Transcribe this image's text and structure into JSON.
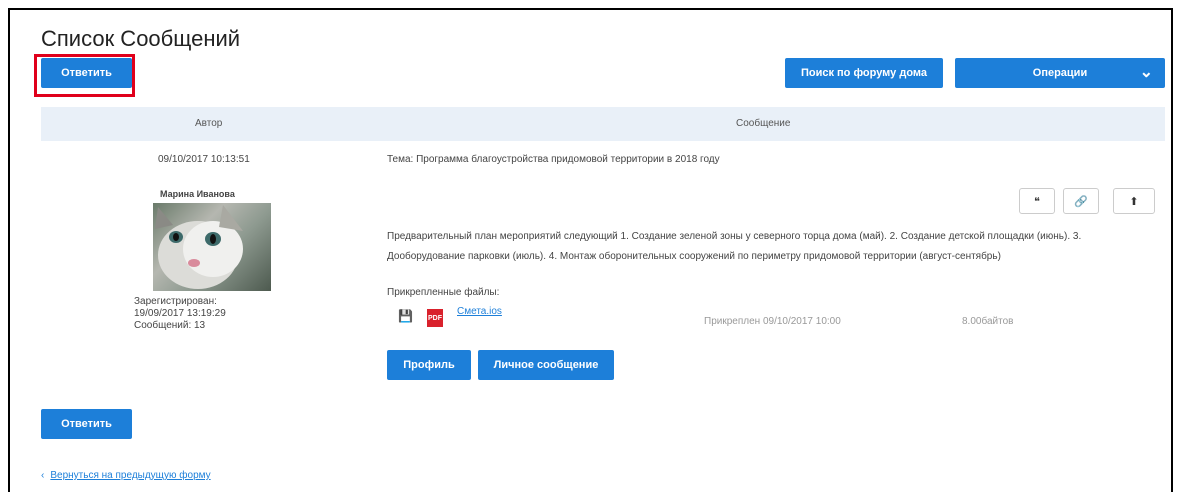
{
  "page": {
    "title": "Список Сообщений"
  },
  "toolbar": {
    "reply_label": "Ответить",
    "search_label": "Поиск по форуму дома",
    "operations_label": "Операции"
  },
  "table": {
    "col_author": "Автор",
    "col_message": "Сообщение"
  },
  "post": {
    "date": "09/10/2017 10:13:51",
    "subject": "Тема: Программа благоустройства придомовой территории в 2018 году",
    "author": "Марина Иванова",
    "registered_label": "Зарегистрирован:",
    "registered_date": "19/09/2017 13:19:29",
    "messages_count": "Сообщений: 13",
    "body": "Предварительный план мероприятий следующий 1. Создание зеленой зоны у северного торца дома (май). 2. Создание детской площадки (июнь). 3. Дооборудование парковки (июль). 4. Монтаж оборонительных сооружений по периметру придомовой территории (август-сентябрь)",
    "attachments_label": "Прикрепленные файлы:",
    "file_link": "Смета.ios",
    "file_date": "Прикреплен 09/10/2017 10:00",
    "file_size": "8.00байтов",
    "profile_label": "Профиль",
    "pm_label": "Личное сообщение",
    "tools": {
      "quote": "❝",
      "link": "🔗",
      "up": "⬆"
    }
  },
  "footer": {
    "back_label": "Вернуться на предыдущую форму"
  }
}
